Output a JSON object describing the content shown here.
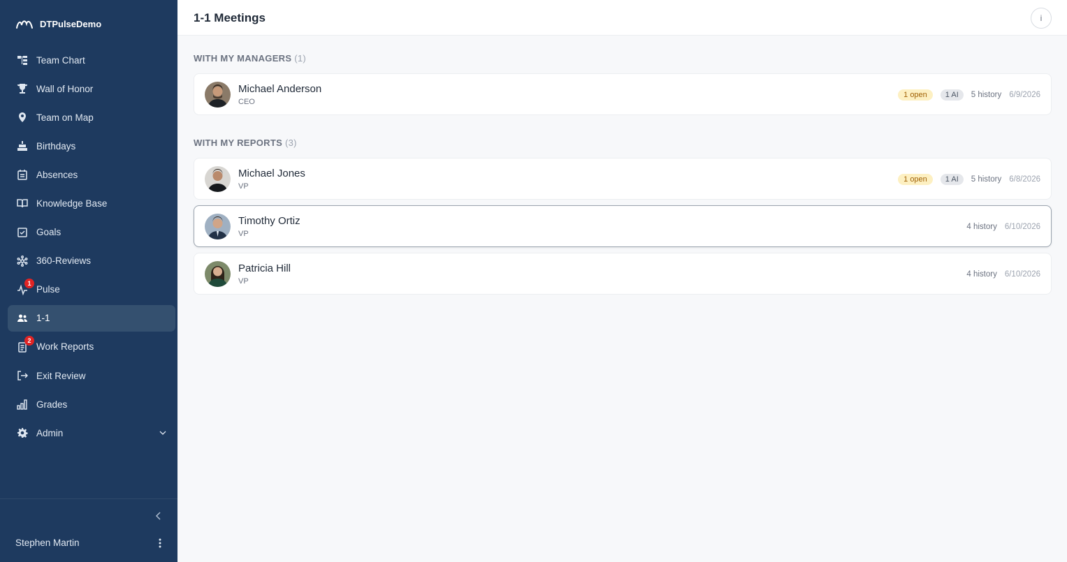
{
  "brand": {
    "name": "DTPulseDemo"
  },
  "nav": {
    "items": [
      {
        "label": "Team Chart",
        "icon": "team-chart-icon"
      },
      {
        "label": "Wall of Honor",
        "icon": "trophy-icon"
      },
      {
        "label": "Team on Map",
        "icon": "map-pin-icon"
      },
      {
        "label": "Birthdays",
        "icon": "cake-icon"
      },
      {
        "label": "Absences",
        "icon": "calendar-icon"
      },
      {
        "label": "Knowledge Base",
        "icon": "book-icon"
      },
      {
        "label": "Goals",
        "icon": "checkbox-icon"
      },
      {
        "label": "360-Reviews",
        "icon": "network-icon"
      },
      {
        "label": "Pulse",
        "icon": "pulse-icon",
        "badge": "1"
      },
      {
        "label": "1-1",
        "icon": "users-icon",
        "active": true
      },
      {
        "label": "Work Reports",
        "icon": "report-icon",
        "badge": "2"
      },
      {
        "label": "Exit Review",
        "icon": "exit-icon"
      },
      {
        "label": "Grades",
        "icon": "bar-chart-icon"
      },
      {
        "label": "Admin",
        "icon": "gear-icon"
      }
    ]
  },
  "user": {
    "name": "Stephen Martin"
  },
  "header": {
    "title": "1-1 Meetings",
    "info_label": "i"
  },
  "managers": {
    "title": "WITH MY MANAGERS",
    "count": "(1)",
    "people": [
      {
        "name": "Michael Anderson",
        "role": "CEO",
        "open": "1 open",
        "ai": "1 AI",
        "history": "5 history",
        "date": "6/9/2026"
      }
    ]
  },
  "reports": {
    "title": "WITH MY REPORTS",
    "count": "(3)",
    "people": [
      {
        "name": "Michael Jones",
        "role": "VP",
        "open": "1 open",
        "ai": "1 AI",
        "history": "5 history",
        "date": "6/8/2026"
      },
      {
        "name": "Timothy Ortiz",
        "role": "VP",
        "history": "4 history",
        "date": "6/10/2026"
      },
      {
        "name": "Patricia Hill",
        "role": "VP",
        "history": "4 history",
        "date": "6/10/2026"
      }
    ]
  },
  "colors": {
    "sidebar_bg": "#1e3a5f",
    "active_item_bg": "#34506f",
    "badge_red": "#e02424",
    "open_pill_bg": "#fdf0c2",
    "open_pill_text": "#a16207",
    "ai_pill_bg": "#e5e7eb"
  }
}
